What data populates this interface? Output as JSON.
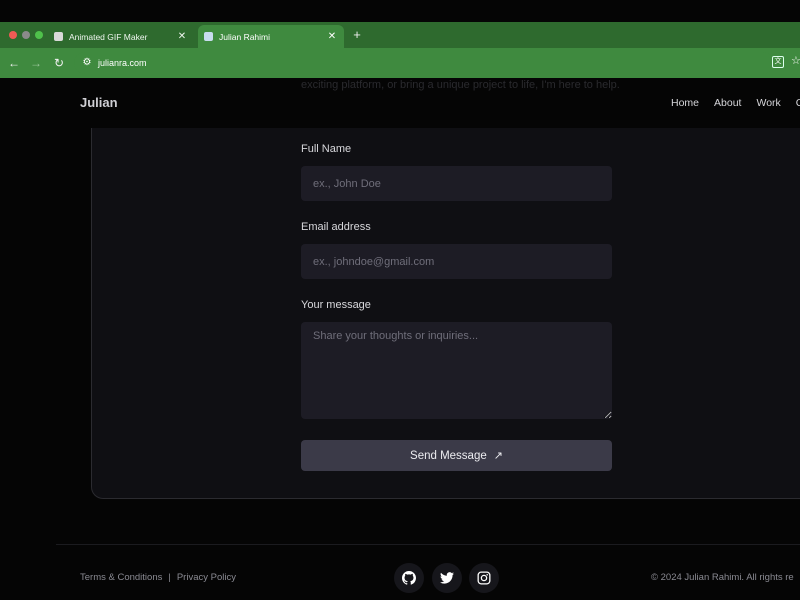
{
  "browser": {
    "tabs": [
      {
        "title": "Animated GIF Maker",
        "active": false
      },
      {
        "title": "Julian Rahimi",
        "active": true
      }
    ],
    "new_tab": "+",
    "url": "julianra.com",
    "colors": {
      "chrome": "#2e6a2e",
      "active": "#3f8a3f"
    }
  },
  "site": {
    "logo": "Julian",
    "nav": [
      "Home",
      "About",
      "Work",
      "C"
    ],
    "intro_text": "exciting platform, or bring a unique project to life, I'm here to help."
  },
  "form": {
    "name": {
      "label": "Full Name",
      "placeholder": "ex., John Doe"
    },
    "email": {
      "label": "Email address",
      "placeholder": "ex., johndoe@gmail.com"
    },
    "message": {
      "label": "Your message",
      "placeholder": "Share your thoughts or inquiries..."
    },
    "submit": {
      "label": "Send Message",
      "icon": "arrow-up-right-icon"
    }
  },
  "footer": {
    "terms": "Terms & Conditions",
    "separator": "|",
    "privacy": "Privacy Policy",
    "social": [
      "github-icon",
      "twitter-icon",
      "instagram-icon"
    ],
    "copyright": "© 2024 Julian Rahimi. All rights re"
  }
}
